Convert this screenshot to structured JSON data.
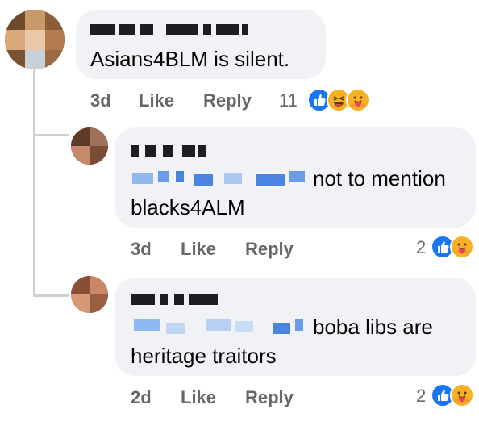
{
  "comments": [
    {
      "text": "Asians4BLM is silent.",
      "time": "3d",
      "like_label": "Like",
      "reply_label": "Reply",
      "reaction_count": "11",
      "reactions": [
        "like-icon",
        "haha-icon",
        "care-icon"
      ]
    },
    {
      "text_line1": "not to mention",
      "text_line2": "blacks4ALM",
      "time": "3d",
      "like_label": "Like",
      "reply_label": "Reply",
      "reaction_count": "2",
      "reactions": [
        "like-icon",
        "care-icon"
      ]
    },
    {
      "text_line1": "boba libs are",
      "text_line2": "heritage traitors",
      "time": "2d",
      "like_label": "Like",
      "reply_label": "Reply",
      "reaction_count": "2",
      "reactions": [
        "like-icon",
        "care-icon"
      ]
    }
  ],
  "colors": {
    "bubble": "#f0f2f5",
    "meta_text": "#65676b",
    "like_blue": "#1877f2",
    "thread_line": "#ccd0d5"
  }
}
